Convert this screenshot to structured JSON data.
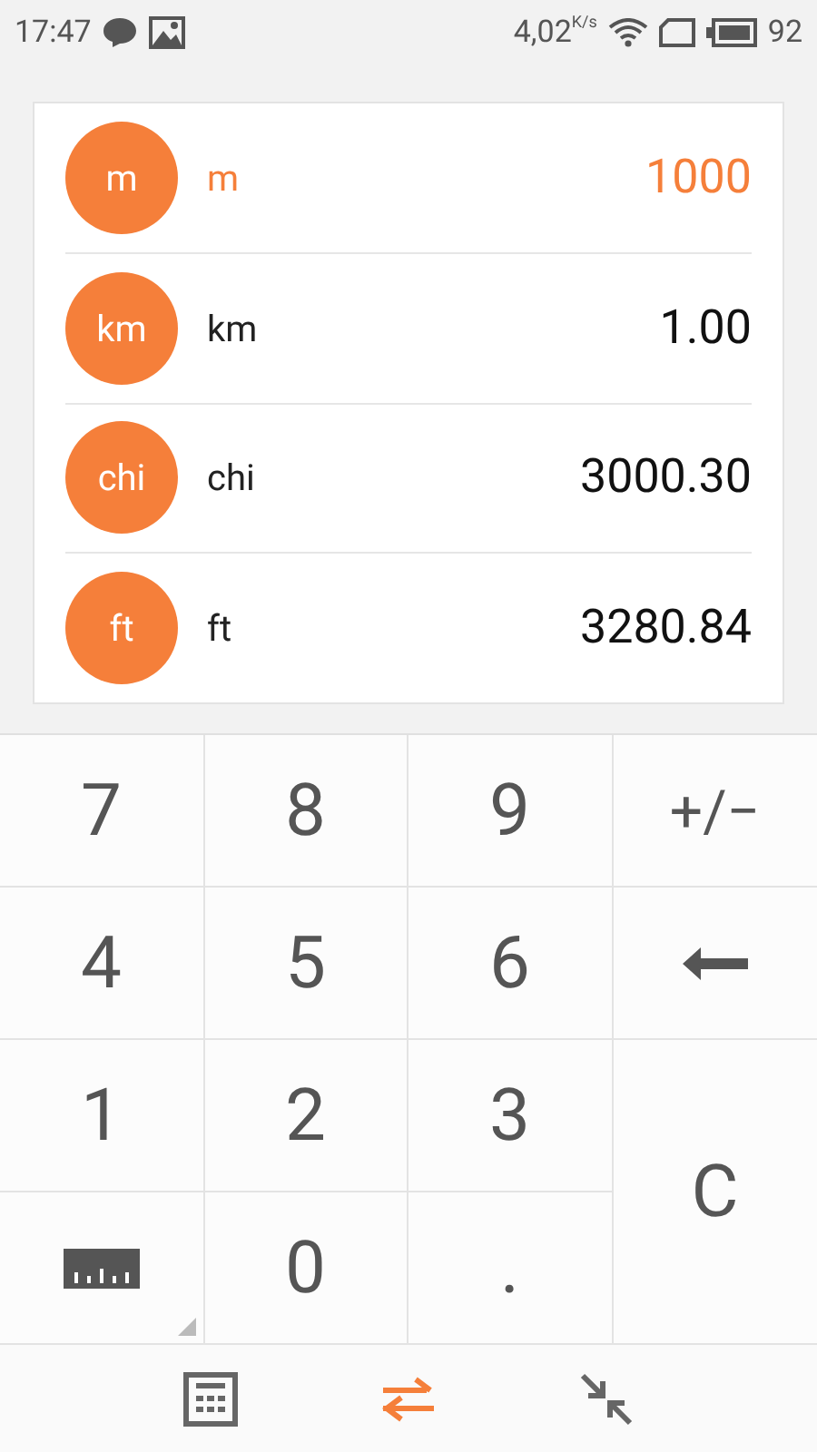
{
  "status_bar": {
    "time": "17:47",
    "speed": "4,02",
    "speed_unit": "K/s",
    "battery": "92"
  },
  "units": [
    {
      "badge": "m",
      "name": "m",
      "value": "1000",
      "selected": true
    },
    {
      "badge": "km",
      "name": "km",
      "value": "1.00",
      "selected": false
    },
    {
      "badge": "chi",
      "name": "chi",
      "value": "3000.30",
      "selected": false
    },
    {
      "badge": "ft",
      "name": "ft",
      "value": "3280.84",
      "selected": false
    }
  ],
  "keys": [
    {
      "kind": "digit",
      "label": "7"
    },
    {
      "kind": "digit",
      "label": "8"
    },
    {
      "kind": "digit",
      "label": "9"
    },
    {
      "kind": "sign",
      "label": "+/−"
    },
    {
      "kind": "digit",
      "label": "4"
    },
    {
      "kind": "digit",
      "label": "5"
    },
    {
      "kind": "digit",
      "label": "6"
    },
    {
      "kind": "backspace"
    },
    {
      "kind": "digit",
      "label": "1"
    },
    {
      "kind": "digit",
      "label": "2"
    },
    {
      "kind": "digit",
      "label": "3"
    },
    {
      "kind": "clear",
      "label": "C"
    },
    {
      "kind": "ruler"
    },
    {
      "kind": "digit",
      "label": "0"
    },
    {
      "kind": "digit",
      "label": "."
    }
  ],
  "nav": [
    {
      "kind": "calculator",
      "selected": false
    },
    {
      "kind": "convert",
      "selected": true
    },
    {
      "kind": "collapse",
      "selected": false
    }
  ]
}
